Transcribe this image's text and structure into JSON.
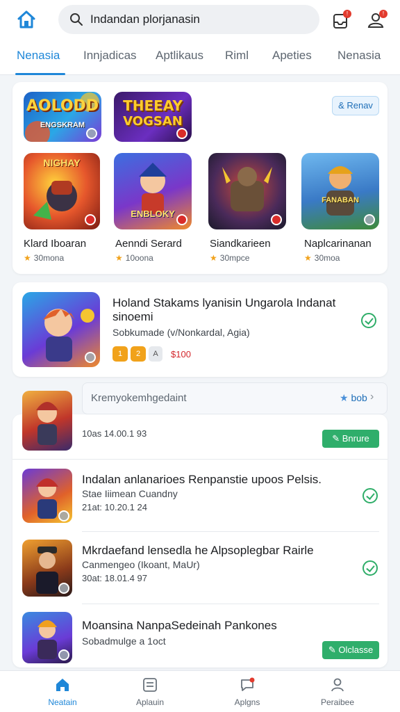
{
  "colors": {
    "accent": "#1f87d8",
    "success": "#2fae6b",
    "badge": "#e23b2e",
    "rating_star": "#f1a21b",
    "price": "#d3262b"
  },
  "header": {
    "home_icon": "home-icon",
    "search_icon": "search-icon",
    "search_value": "Indandan plorjanasin",
    "inbox_icon": "inbox-icon",
    "inbox_badge": "!",
    "profile_icon": "profile-alert-icon",
    "profile_badge": "!"
  },
  "tabs": [
    "Nenasia",
    "Innjadicas",
    "Aptlikaus",
    "Riml",
    "Apeties",
    "Nenasia"
  ],
  "active_tab": 0,
  "featured": {
    "banner_1": {
      "title_line1": "AOLODD",
      "title_line2": "ENGSKRAM"
    },
    "banner_2": {
      "title_line1": "THEEAY",
      "title_line2": "VOGSAN"
    },
    "follow_label": "& Renav",
    "games": [
      {
        "art_text": "NIGHAY",
        "name": "Klard Iboaran",
        "rating": "30mona"
      },
      {
        "art_text": "ENBLOKY",
        "name": "Aenndi Serard",
        "rating": "10oona"
      },
      {
        "art_text": "",
        "name": "Siandkarieen",
        "rating": "30mpce"
      },
      {
        "art_text": "FANABAN",
        "name": "Naplcarinanan",
        "rating": "30moa"
      }
    ]
  },
  "promo": {
    "title": "Holand Stakams lyanisin Ungarola Indanat",
    "title_line2": "sinoemi",
    "subtitle": "Sobkumade (v/Nonkardal, Agia)",
    "tags": [
      "1",
      "2",
      "A"
    ],
    "price": "$100"
  },
  "note_row": {
    "text": "Kremyokemhgedaint",
    "action": "bob"
  },
  "update_items": [
    {
      "date": "10as 14.00.1 93",
      "action": "Bnrure"
    },
    {
      "title": "Indalan anlanarioes Renpanstie upoos Pelsis.",
      "subtitle": "Stae Iiimean Cuandny",
      "date": "21at: 10.20.1 24"
    },
    {
      "title": "Mkrdaefand lensedla he Alpsoplegbar Rairle",
      "subtitle": "Canmengeo (Ikoant, MaUr)",
      "date": "30at: 18.01.4 97"
    },
    {
      "title": "Moansina NanpaSedeinah Pankones",
      "subtitle": "Sobadmulge a 1oct",
      "action": "Olclasse"
    }
  ],
  "bottom_nav": [
    {
      "label": "Neatain",
      "icon": "home-icon"
    },
    {
      "label": "Aplauin",
      "icon": "apps-icon"
    },
    {
      "label": "Aplgns",
      "icon": "chat-icon"
    },
    {
      "label": "Peraibee",
      "icon": "person-icon"
    }
  ],
  "active_nav": 0
}
